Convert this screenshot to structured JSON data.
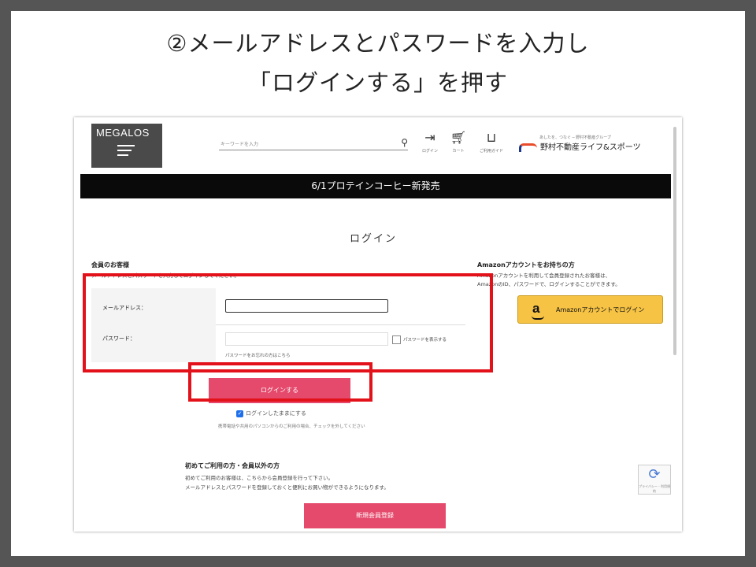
{
  "slide": {
    "title_line1": "②メールアドレスとパスワードを入力し",
    "title_line2": "「ログインする」を押す"
  },
  "header": {
    "logo": "MEGALOS",
    "search_placeholder": "キーワードを入力",
    "icons": [
      {
        "icon": "login-icon",
        "label": "ログイン"
      },
      {
        "icon": "cart-icon",
        "label": "カート"
      },
      {
        "icon": "guide-icon",
        "label": "ご利用ガイド"
      }
    ],
    "brand_sub": "あしたを、つなぐ ─ 野村不動産グループ",
    "brand": "野村不動産ライフ&スポーツ"
  },
  "banner": "6/1プロテインコーヒー新発売",
  "page_title": "ログイン",
  "member": {
    "heading": "会員のお客様",
    "note": "メールアドレスとパスワードを入力してログインしてください。",
    "email_label": "メールアドレス：",
    "password_label": "パスワード：",
    "show_password": "パスワードを表示する",
    "forgot": "パスワードをお忘れの方はこちら",
    "login_button": "ログインする",
    "keep_login": "ログインしたままにする",
    "keep_note": "携帯電話や共用のパソコンからのご利用の場合、チェックを外してください"
  },
  "amazon": {
    "heading": "Amazonアカウントをお持ちの方",
    "note_line1": "Amazonアカウントを利用して会員登録されたお客様は、",
    "note_line2": "AmazonのID、パスワードで、ログインすることができます。",
    "button": "Amazonアカウントでログイン"
  },
  "new_user": {
    "heading": "初めてご利用の方・会員以外の方",
    "note_line1": "初めてご利用のお客様は、こちらから会員登録を行って下さい。",
    "note_line2": "メールアドレスとパスワードを登録しておくと便利にお買い物ができるようになります。",
    "register_button": "新規会員登録"
  },
  "recaptcha_text": "プライバシー - 利用規約",
  "colors": {
    "accent": "#e5496b",
    "highlight": "#e3121a",
    "amazon": "#f6c344",
    "banner": "#0a0a0a"
  }
}
